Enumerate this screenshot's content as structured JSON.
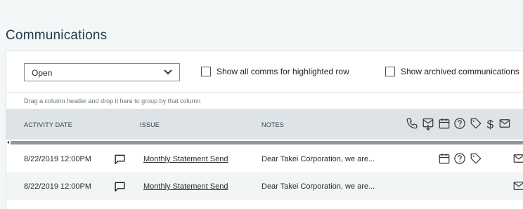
{
  "page": {
    "title": "Communications"
  },
  "filter": {
    "selected": "Open"
  },
  "checkboxes": {
    "highlighted": {
      "label": "Show all comms for highlighted row",
      "checked": false
    },
    "archived": {
      "label": "Show archived communications",
      "checked": false
    }
  },
  "grid": {
    "group_hint": "Drag a column header and drop it here to group by that column",
    "columns": {
      "activity_date": "ACTIVITY DATE",
      "issue": "ISSUE",
      "notes": "NOTES"
    },
    "header_icons": [
      "phone-icon",
      "inbox-download-icon",
      "calendar-icon",
      "question-icon",
      "tag-icon",
      "dollar-icon",
      "envelope-icon"
    ],
    "rows": [
      {
        "date": "8/22/2019 12:00PM",
        "issue": "Monthly Statement Send",
        "notes": "Dear Takei Corporation, we are...",
        "icons": [
          "chat-icon",
          "calendar-icon",
          "question-icon",
          "tag-icon",
          "envelope-icon"
        ]
      },
      {
        "date": "8/22/2019 12:00PM",
        "issue": "Monthly Statement Send",
        "notes": "Dear Takei Corporation, we are...",
        "icons": [
          "chat-icon",
          "envelope-icon"
        ]
      }
    ]
  },
  "colors": {
    "header_bg": "#dde3e6",
    "page_bg": "#f4f7f8",
    "title": "#243b4a"
  }
}
